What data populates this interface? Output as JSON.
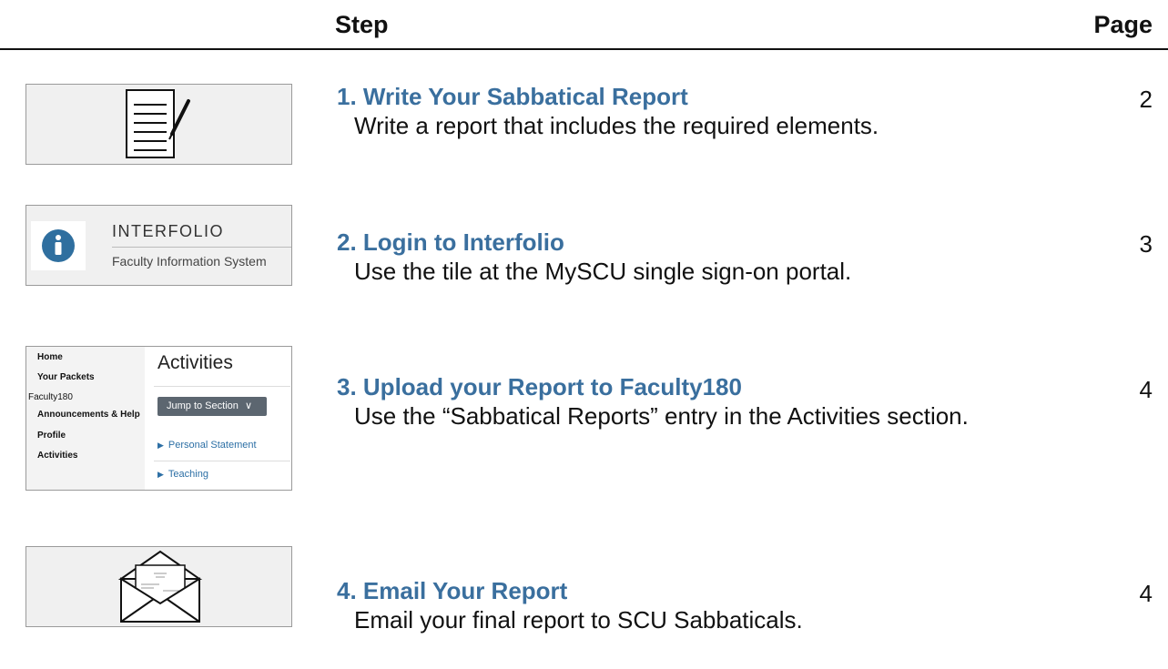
{
  "header": {
    "step_label": "Step",
    "page_label": "Page"
  },
  "steps": [
    {
      "title": "1. Write Your Sabbatical Report",
      "desc": "Write a report that includes the required elements.",
      "page": "2",
      "thumb_icon": "document-pen-icon"
    },
    {
      "title": "2. Login to Interfolio",
      "desc": "Use the tile at the MySCU single sign-on portal.",
      "page": "3",
      "thumb_icon": "info-icon"
    },
    {
      "title": "3. Upload your Report to Faculty180",
      "desc": "Use the “Sabbatical Reports” entry in the Activities section.",
      "page": "4",
      "thumb_icon": "faculty180-screenshot"
    },
    {
      "title": "4. Email Your Report",
      "desc": "Email your final report to SCU Sabbaticals.",
      "page": "4",
      "thumb_icon": "envelope-letter-icon"
    }
  ],
  "interfolio_tile": {
    "name": "INTERFOLIO",
    "subtitle": "Faculty Information System"
  },
  "faculty180": {
    "nav": [
      "Home",
      "Your Packets",
      "Faculty180",
      "Announcements & Help",
      "Profile",
      "Activities"
    ],
    "title": "Activities",
    "jump_label": "Jump to Section",
    "sections": [
      "Personal Statement",
      "Teaching"
    ]
  },
  "colors": {
    "step_title": "#3a6f9e",
    "thumb_bg": "#f0f0f0",
    "thumb_border": "#9a9a9a",
    "info_blue": "#2f6f9f"
  }
}
